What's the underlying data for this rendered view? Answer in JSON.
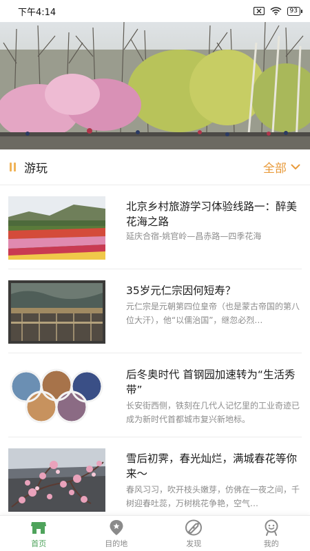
{
  "status_bar": {
    "time": "下午4:14",
    "battery": "93"
  },
  "section": {
    "title": "游玩",
    "see_all": "全部"
  },
  "articles": [
    {
      "title": "北京乡村旅游学习体验线路一：醉美花海之路",
      "desc": "延庆合宿-姚官岭—昌赤路—四季花海"
    },
    {
      "title": "35岁元仁宗因何短寿？",
      "desc": "元仁宗是元朝第四位皇帝（也是蒙古帝国的第八位大汗），他“以儒治国”，继忽必烈…"
    },
    {
      "title": "后冬奥时代 首钢园加速转为“生活秀带”",
      "desc": "长安街西侧，铁刻在几代人记忆里的工业奇迹已成为新时代首都城市复兴新地标。"
    },
    {
      "title": "雪后初霁，春光灿烂，满城春花等你来～",
      "desc": "春风习习，吹开枝头嫩芽，仿佛在一夜之间，千树迎春吐蕊，万树桃花争艳，空气…"
    }
  ],
  "tabs": [
    {
      "label": "首页",
      "icon": "home-store-icon",
      "active": true
    },
    {
      "label": "目的地",
      "icon": "location-pin-star-icon",
      "active": false
    },
    {
      "label": "发现",
      "icon": "compass-icon",
      "active": false
    },
    {
      "label": "我的",
      "icon": "user-face-icon",
      "active": false
    }
  ],
  "colors": {
    "accent": "#e89a3a",
    "marker": "#f0b357",
    "active_tab": "#4ea35b",
    "inactive_tab": "#8a8a8a",
    "desc_text": "#8c8c8c"
  }
}
